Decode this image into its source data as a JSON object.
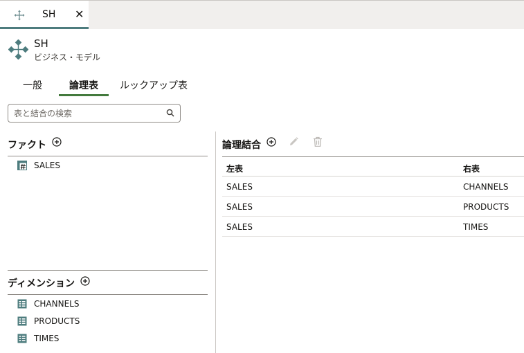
{
  "document_tab": {
    "label": "SH",
    "close_glyph": "✕"
  },
  "model": {
    "name": "SH",
    "type": "ビジネス・モデル",
    "icon": "business-model-icon"
  },
  "tabs": [
    {
      "label": "一般",
      "active": false
    },
    {
      "label": "論理表",
      "active": true
    },
    {
      "label": "ルックアップ表",
      "active": false
    }
  ],
  "search": {
    "placeholder": "表と結合の検索",
    "value": ""
  },
  "facts": {
    "title": "ファクト",
    "items": [
      {
        "label": "SALES",
        "icon": "fact-table-icon"
      }
    ]
  },
  "dimensions": {
    "title": "ディメンション",
    "items": [
      {
        "label": "CHANNELS",
        "icon": "dimension-table-icon"
      },
      {
        "label": "PRODUCTS",
        "icon": "dimension-table-icon"
      },
      {
        "label": "TIMES",
        "icon": "dimension-table-icon"
      }
    ]
  },
  "joins": {
    "title": "論理結合",
    "columns": {
      "left": "左表",
      "right": "右表"
    },
    "rows": [
      {
        "left": "SALES",
        "right": "CHANNELS"
      },
      {
        "left": "SALES",
        "right": "PRODUCTS"
      },
      {
        "left": "SALES",
        "right": "TIMES"
      }
    ]
  },
  "colors": {
    "accent_teal": "#4d7c7e",
    "active_tab_underline": "#437a3d",
    "icon_gray": "#b9b6b2"
  }
}
